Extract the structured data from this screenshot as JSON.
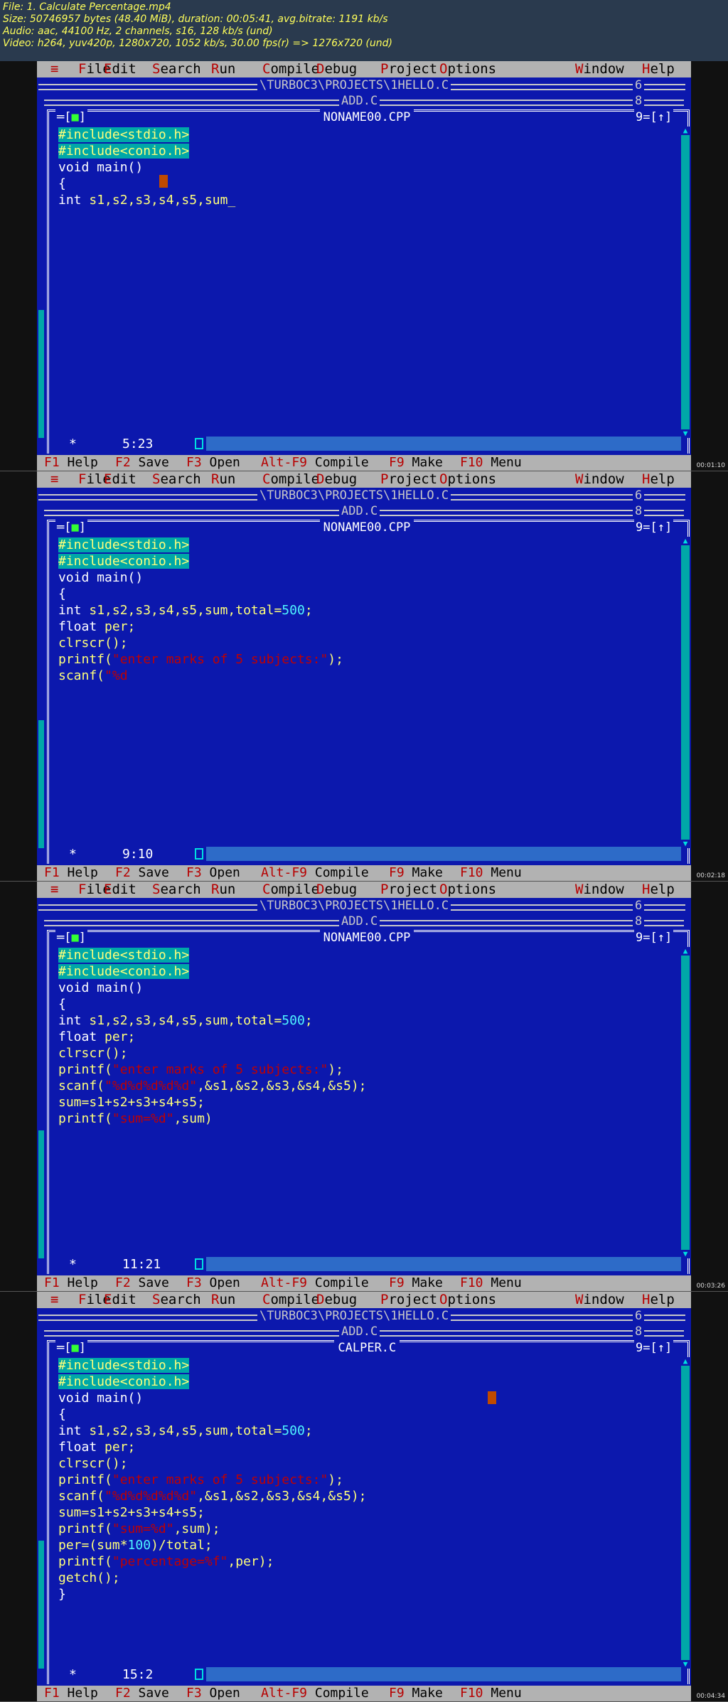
{
  "info": {
    "file": "File: 1. Calculate Percentage.mp4",
    "size": "Size: 50746957 bytes (48.40 MiB), duration: 00:05:41, avg.bitrate: 1191 kb/s",
    "audio": "Audio: aac, 44100 Hz, 2 channels, s16, 128 kb/s (und)",
    "video": "Video: h264, yuv420p, 1280x720, 1052 kb/s, 30.00 fps(r) => 1276x720 (und)"
  },
  "menu": {
    "system": "≡",
    "items": [
      {
        "hot": "F",
        "rest": "ile"
      },
      {
        "hot": "E",
        "rest": "dit"
      },
      {
        "hot": "S",
        "rest": "earch"
      },
      {
        "hot": "R",
        "rest": "un"
      },
      {
        "hot": "C",
        "rest": "ompile"
      },
      {
        "hot": "D",
        "rest": "ebug"
      },
      {
        "hot": "P",
        "rest": "roject"
      },
      {
        "hot": "O",
        "rest": "ptions"
      },
      {
        "hot": "W",
        "rest": "indow"
      },
      {
        "hot": "H",
        "rest": "elp"
      }
    ]
  },
  "windows": {
    "back1": {
      "title": "\\TURBOC3\\PROJECTS\\1HELLO.C",
      "num": "6"
    },
    "back2": {
      "title": "ADD.C",
      "num": "8"
    }
  },
  "fnbar": [
    {
      "key": "F1",
      "label": " Help"
    },
    {
      "key": "F2",
      "label": " Save"
    },
    {
      "key": "F3",
      "label": " Open"
    },
    {
      "key": "Alt-F9",
      "label": " Compile"
    },
    {
      "key": "F9",
      "label": " Make"
    },
    {
      "key": "F10",
      "label": " Menu"
    }
  ],
  "frames": [
    {
      "editor_title": "NONAME00.CPP",
      "win_num": "9=[↑]",
      "win_left": "═[■]",
      "position": "5:23",
      "stamp": "00:01:10",
      "code": [
        [
          {
            "t": "#include<stdio.h>",
            "c": "inc"
          }
        ],
        [
          {
            "t": "#include<conio.h>",
            "c": "inc"
          }
        ],
        [
          {
            "t": "void main()",
            "c": "kw"
          }
        ],
        [
          {
            "t": "{",
            "c": "kw"
          }
        ],
        [
          {
            "t": "int ",
            "c": "kw"
          },
          {
            "t": "s1,s2,s3,s4,s5,sum_",
            "c": ""
          }
        ]
      ]
    },
    {
      "editor_title": "NONAME00.CPP",
      "win_num": "9=[↑]",
      "win_left": "═[■]",
      "position": "9:10",
      "stamp": "00:02:18",
      "code": [
        [
          {
            "t": "#include<stdio.h>",
            "c": "inc"
          }
        ],
        [
          {
            "t": "#include<conio.h>",
            "c": "inc"
          }
        ],
        [
          {
            "t": "void main()",
            "c": "kw"
          }
        ],
        [
          {
            "t": "{",
            "c": "kw"
          }
        ],
        [
          {
            "t": "int ",
            "c": "kw"
          },
          {
            "t": "s1,s2,s3,s4,s5,sum,total=",
            "c": ""
          },
          {
            "t": "500",
            "c": "num"
          },
          {
            "t": ";",
            "c": ""
          }
        ],
        [
          {
            "t": "float ",
            "c": "kw"
          },
          {
            "t": "per;",
            "c": ""
          }
        ],
        [
          {
            "t": "clrscr();",
            "c": ""
          }
        ],
        [
          {
            "t": "printf(",
            "c": ""
          },
          {
            "t": "\"enter marks of 5 subjects:\"",
            "c": "str"
          },
          {
            "t": ");",
            "c": ""
          }
        ],
        [
          {
            "t": "scanf(",
            "c": ""
          },
          {
            "t": "\"%d",
            "c": "str"
          }
        ]
      ]
    },
    {
      "editor_title": "NONAME00.CPP",
      "win_num": "9=[↑]",
      "win_left": "═[■]",
      "position": "11:21",
      "stamp": "00:03:26",
      "code": [
        [
          {
            "t": "#include<stdio.h>",
            "c": "inc"
          }
        ],
        [
          {
            "t": "#include<conio.h>",
            "c": "inc"
          }
        ],
        [
          {
            "t": "void main()",
            "c": "kw"
          }
        ],
        [
          {
            "t": "{",
            "c": "kw"
          }
        ],
        [
          {
            "t": "int ",
            "c": "kw"
          },
          {
            "t": "s1,s2,s3,s4,s5,sum,total=",
            "c": ""
          },
          {
            "t": "500",
            "c": "num"
          },
          {
            "t": ";",
            "c": ""
          }
        ],
        [
          {
            "t": "float ",
            "c": "kw"
          },
          {
            "t": "per;",
            "c": ""
          }
        ],
        [
          {
            "t": "clrscr();",
            "c": ""
          }
        ],
        [
          {
            "t": "printf(",
            "c": ""
          },
          {
            "t": "\"enter marks of 5 subjects:\"",
            "c": "str"
          },
          {
            "t": ");",
            "c": ""
          }
        ],
        [
          {
            "t": "scanf(",
            "c": ""
          },
          {
            "t": "\"%d%d%d%d%d\"",
            "c": "str"
          },
          {
            "t": ",&s1,&s2,&s3,&s4,&s5);",
            "c": ""
          }
        ],
        [
          {
            "t": "sum=s1+s2+s3+s4+s5;",
            "c": ""
          }
        ],
        [
          {
            "t": "printf(",
            "c": ""
          },
          {
            "t": "\"sum=%d\"",
            "c": "str"
          },
          {
            "t": ",sum)",
            "c": ""
          }
        ]
      ]
    },
    {
      "editor_title": "CALPER.C",
      "win_num": "9=[↑]",
      "win_left": "═[■]",
      "position": "15:2",
      "stamp": "00:04:34",
      "code": [
        [
          {
            "t": "#include<stdio.h>",
            "c": "inc"
          }
        ],
        [
          {
            "t": "#include<conio.h>",
            "c": "inc"
          }
        ],
        [
          {
            "t": "void main()",
            "c": "kw"
          }
        ],
        [
          {
            "t": "{",
            "c": "kw"
          }
        ],
        [
          {
            "t": "int ",
            "c": "kw"
          },
          {
            "t": "s1,s2,s3,s4,s5,sum,total=",
            "c": ""
          },
          {
            "t": "500",
            "c": "num"
          },
          {
            "t": ";",
            "c": ""
          }
        ],
        [
          {
            "t": "float ",
            "c": "kw"
          },
          {
            "t": "per;",
            "c": ""
          }
        ],
        [
          {
            "t": "clrscr();",
            "c": ""
          }
        ],
        [
          {
            "t": "printf(",
            "c": ""
          },
          {
            "t": "\"enter marks of 5 subjects:\"",
            "c": "str"
          },
          {
            "t": ");",
            "c": ""
          }
        ],
        [
          {
            "t": "scanf(",
            "c": ""
          },
          {
            "t": "\"%d%d%d%d%d\"",
            "c": "str"
          },
          {
            "t": ",&s1,&s2,&s3,&s4,&s5);",
            "c": ""
          }
        ],
        [
          {
            "t": "sum=s1+s2+s3+s4+s5;",
            "c": ""
          }
        ],
        [
          {
            "t": "printf(",
            "c": ""
          },
          {
            "t": "\"sum=%d\"",
            "c": "str"
          },
          {
            "t": ",sum);",
            "c": ""
          }
        ],
        [
          {
            "t": "per=(sum*",
            "c": ""
          },
          {
            "t": "100",
            "c": "num"
          },
          {
            "t": ")/total;",
            "c": ""
          }
        ],
        [
          {
            "t": "printf(",
            "c": ""
          },
          {
            "t": "\"percentage=%f\"",
            "c": "str"
          },
          {
            "t": ",per);",
            "c": ""
          }
        ],
        [
          {
            "t": "getch();",
            "c": ""
          }
        ],
        [
          {
            "t": "}",
            "c": "kw"
          }
        ]
      ]
    }
  ],
  "colors": {
    "screen_bg": "#0c18ad",
    "menu_bg": "#b2b2b2",
    "hotkey": "#b70000",
    "include_bg": "#00a8a8",
    "string": "#c00000",
    "code_text": "#ffff7a"
  }
}
